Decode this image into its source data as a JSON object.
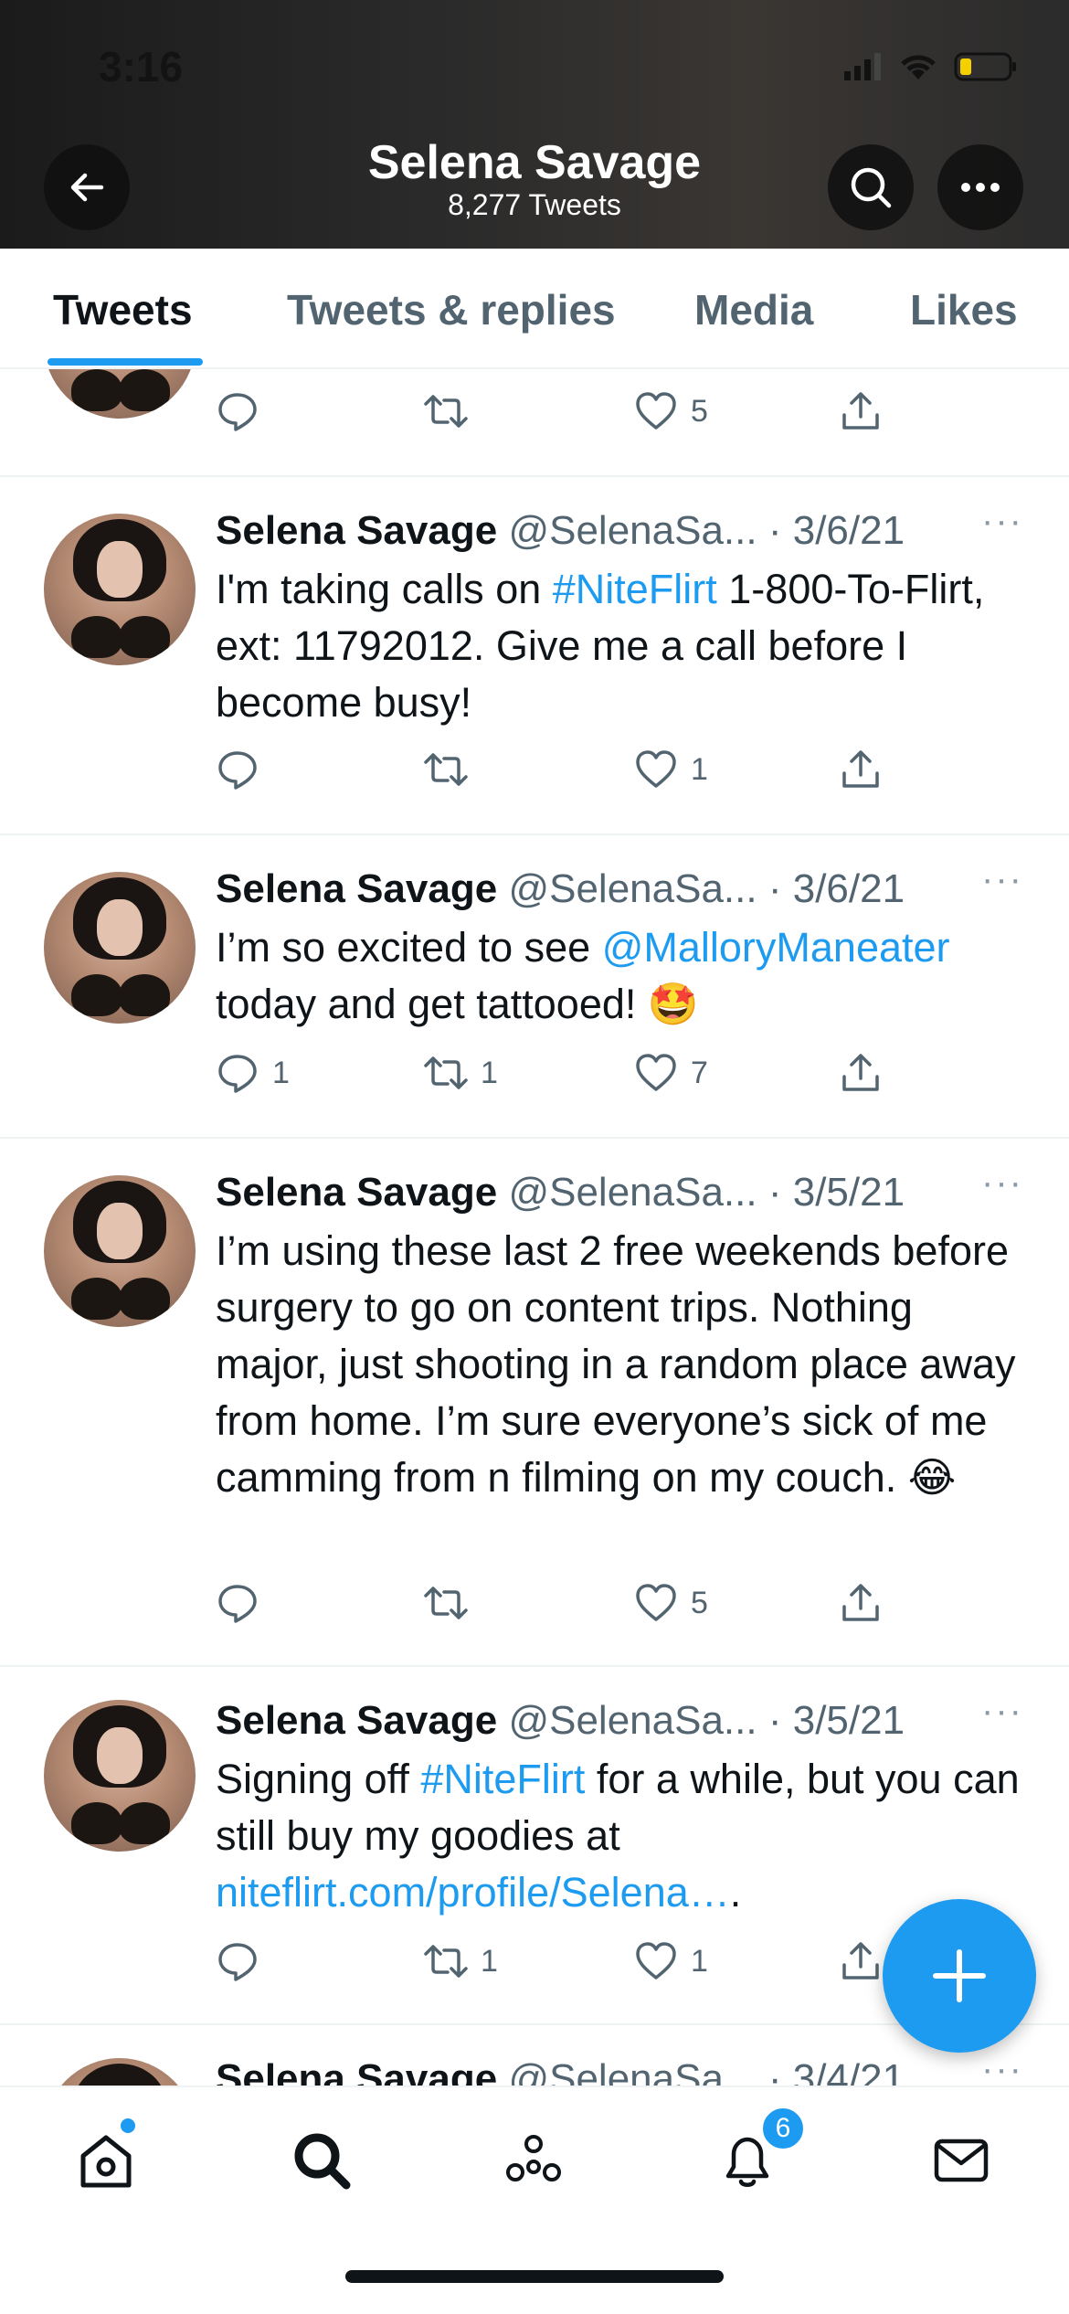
{
  "status_bar": {
    "time": "3:16"
  },
  "header": {
    "title": "Selena Savage",
    "subtitle": "8,277 Tweets"
  },
  "tabs": [
    {
      "label": "Tweets",
      "active": true
    },
    {
      "label": "Tweets & replies",
      "active": false
    },
    {
      "label": "Media",
      "active": false
    },
    {
      "label": "Likes",
      "active": false
    }
  ],
  "partial_tweet_top": {
    "likes": "5"
  },
  "tweets": [
    {
      "name": "Selena Savage",
      "handle": "@SelenaSa...",
      "date": "· 3/6/21",
      "text_parts": [
        {
          "t": "I'm taking calls on ",
          "link": false
        },
        {
          "t": "#NiteFlirt",
          "link": true
        },
        {
          "t": " 1-800-To-Flirt, ext: 11792012. Give me a call before I become busy!",
          "link": false
        }
      ],
      "replies": "",
      "retweets": "",
      "likes": "1"
    },
    {
      "name": "Selena Savage",
      "handle": "@SelenaSa...",
      "date": "· 3/6/21",
      "text_parts": [
        {
          "t": "I’m so excited to see ",
          "link": false
        },
        {
          "t": "@MalloryManeater",
          "link": true
        },
        {
          "t": " today and get tattooed! 🤩",
          "link": false
        }
      ],
      "replies": "1",
      "retweets": "1",
      "likes": "7"
    },
    {
      "name": "Selena Savage",
      "handle": "@SelenaSa...",
      "date": "· 3/5/21",
      "text_parts": [
        {
          "t": "I’m using these last 2 free weekends before surgery to go on content trips. Nothing major, just shooting in a random place away from home. I’m sure everyone’s sick of me camming from n filming on my couch. 😂",
          "link": false
        }
      ],
      "replies": "",
      "retweets": "",
      "likes": "5"
    },
    {
      "name": "Selena Savage",
      "handle": "@SelenaSa...",
      "date": "· 3/5/21",
      "text_parts": [
        {
          "t": "Signing off ",
          "link": false
        },
        {
          "t": "#NiteFlirt",
          "link": true
        },
        {
          "t": " for a while, but you can still buy my goodies at ",
          "link": false
        },
        {
          "t": "niteflirt.com/profile/Selena…",
          "link": true
        },
        {
          "t": ".",
          "link": false
        }
      ],
      "replies": "",
      "retweets": "1",
      "likes": "1"
    },
    {
      "name": "Selena Savage",
      "handle": "@SelenaSa...",
      "date": "· 3/4/21",
      "text_parts": [],
      "replies": "",
      "retweets": "",
      "likes": ""
    }
  ],
  "nav": {
    "notifications_badge": "6"
  },
  "colors": {
    "accent": "#1d9bf0",
    "text": "#0f1419",
    "muted": "#536471"
  }
}
